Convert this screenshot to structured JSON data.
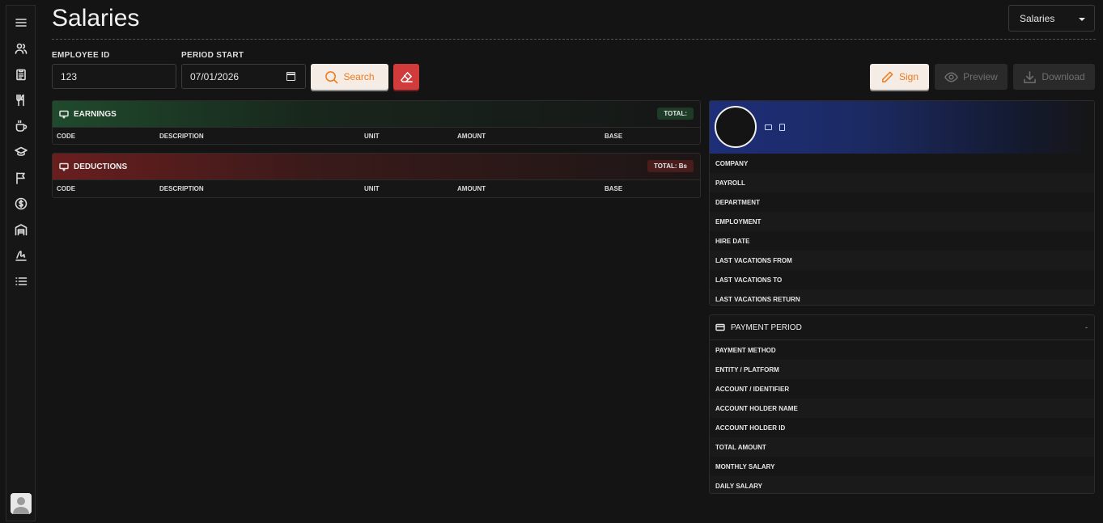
{
  "sidebar": {
    "items": [
      {
        "icon": "menu-icon"
      },
      {
        "icon": "users-icon"
      },
      {
        "icon": "clipboard-icon"
      },
      {
        "icon": "utensils-icon"
      },
      {
        "icon": "coffee-icon"
      },
      {
        "icon": "graduation-cap-icon"
      },
      {
        "icon": "flag-icon"
      },
      {
        "icon": "dollar-icon"
      },
      {
        "icon": "warehouse-icon"
      },
      {
        "icon": "signature-icon"
      },
      {
        "icon": "list-icon"
      }
    ],
    "avatar": "user-avatar-icon"
  },
  "header": {
    "title": "Salaries",
    "selector_value": "Salaries"
  },
  "form": {
    "employee_id_label": "EMPLOYEE ID",
    "employee_id_value": "123",
    "period_start_label": "PERIOD START",
    "period_start_value": "07/01/2026",
    "search_label": "Search"
  },
  "actions": {
    "sign_label": "Sign",
    "preview_label": "Preview",
    "download_label": "Download"
  },
  "earnings": {
    "title": "EARNINGS",
    "total": "TOTAL:",
    "columns": [
      "CODE",
      "DESCRIPTION",
      "UNIT",
      "AMOUNT",
      "BASE"
    ]
  },
  "deductions": {
    "title": "DEDUCTIONS",
    "total": "TOTAL: Bs",
    "columns": [
      "CODE",
      "DESCRIPTION",
      "UNIT",
      "AMOUNT",
      "BASE"
    ]
  },
  "employee_info": {
    "rows": [
      "COMPANY",
      "PAYROLL",
      "DEPARTMENT",
      "EMPLOYMENT",
      "HIRE DATE",
      "LAST VACATIONS FROM",
      "LAST VACATIONS TO",
      "LAST VACATIONS RETURN"
    ]
  },
  "payment": {
    "title": "PAYMENT PERIOD",
    "value": "-",
    "rows": [
      "PAYMENT METHOD",
      "ENTITY / PLATFORM",
      "ACCOUNT / IDENTIFIER",
      "ACCOUNT HOLDER NAME",
      "ACCOUNT HOLDER ID",
      "TOTAL AMOUNT",
      "MONTHLY SALARY",
      "DAILY SALARY"
    ]
  },
  "colors": {
    "accent": "#f07a1a",
    "danger": "#d23b3b",
    "earnings": "#1f4a2c",
    "deductions": "#6a1e1e",
    "profile_banner": "#1e2e78"
  }
}
